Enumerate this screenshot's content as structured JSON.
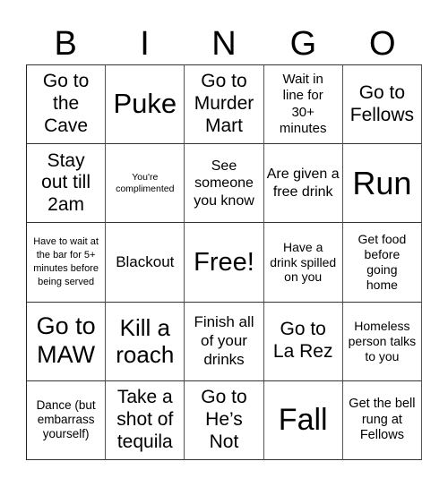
{
  "header": {
    "letters": [
      "B",
      "I",
      "N",
      "G",
      "O"
    ]
  },
  "grid": {
    "rows": [
      [
        "Go to the Cave",
        "Puke",
        "Go to Murder Mart",
        "Wait in line for 30+ minutes",
        "Go to Fellows"
      ],
      [
        "Stay out till 2am",
        "You're complimented",
        "See someone you know",
        "Are given a free drink",
        "Run"
      ],
      [
        "Have to wait at the bar for 5+ minutes before being served",
        "Blackout",
        "Free!",
        "Have a drink spilled on you",
        "Get food before going home"
      ],
      [
        "Go to MAW",
        "Kill a roach",
        "Finish all of your drinks",
        "Go to La Rez",
        "Homeless person talks to you"
      ],
      [
        "Dance (but embarrass yourself)",
        "Take a shot of tequila",
        "Go to He’s Not",
        "Fall",
        "Get the bell rung at Fellows"
      ]
    ]
  }
}
